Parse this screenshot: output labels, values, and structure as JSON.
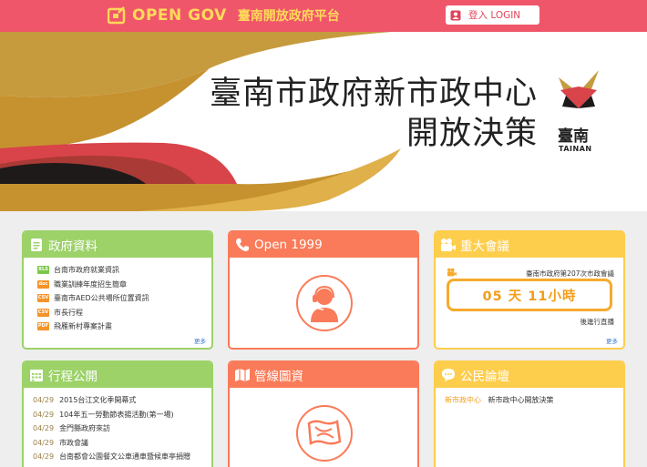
{
  "header": {
    "brand": "OPEN GOV",
    "subtitle": "臺南開放政府平台",
    "login_label": "登入 LOGIN"
  },
  "banner": {
    "title_line1": "臺南市政府新市政中心",
    "title_line2": "開放決策",
    "emblem_zh": "臺南",
    "emblem_en": "TAINAN"
  },
  "cards": {
    "gov_data": {
      "title": "政府資料",
      "items": [
        {
          "format": "XLS",
          "color": "#7cc84a",
          "label": "台南市政府就業資訊"
        },
        {
          "format": "doc",
          "color": "#f5932a",
          "label": "職業訓練年度招生簡章"
        },
        {
          "format": "CSV",
          "color": "#f5932a",
          "label": "臺南市AED公共場所位置資訊"
        },
        {
          "format": "CSV",
          "color": "#f5932a",
          "label": "市長行程"
        },
        {
          "format": "PDF",
          "color": "#f5932a",
          "label": "飛雁新村專案計畫"
        }
      ],
      "more": "更多"
    },
    "open1999": {
      "title": "Open 1999"
    },
    "meeting": {
      "title": "重大會議",
      "meeting_name": "臺南市政府第207次市政會議",
      "countdown": "05 天 11小時",
      "status": "後進行直播",
      "more": "更多"
    },
    "schedule": {
      "title": "行程公開",
      "items": [
        {
          "date": "04/29",
          "label": "2015台江文化季開幕式"
        },
        {
          "date": "04/29",
          "label": "104年五一勞動節表揚活動(第一場)"
        },
        {
          "date": "04/29",
          "label": "金門縣政府來訪"
        },
        {
          "date": "04/29",
          "label": "市政會議"
        },
        {
          "date": "04/29",
          "label": "台南都會公園餐文公車通車暨候車亭捐贈"
        }
      ]
    },
    "pipeline": {
      "title": "管線圖資"
    },
    "forum": {
      "title": "公民論壇",
      "tag": "新市政中心",
      "topic": "新市政中心開放決策"
    }
  },
  "colors": {
    "header": "#f0566a",
    "green": "#9cd268",
    "orange": "#fa7b59",
    "yellow": "#fdcd4c"
  }
}
